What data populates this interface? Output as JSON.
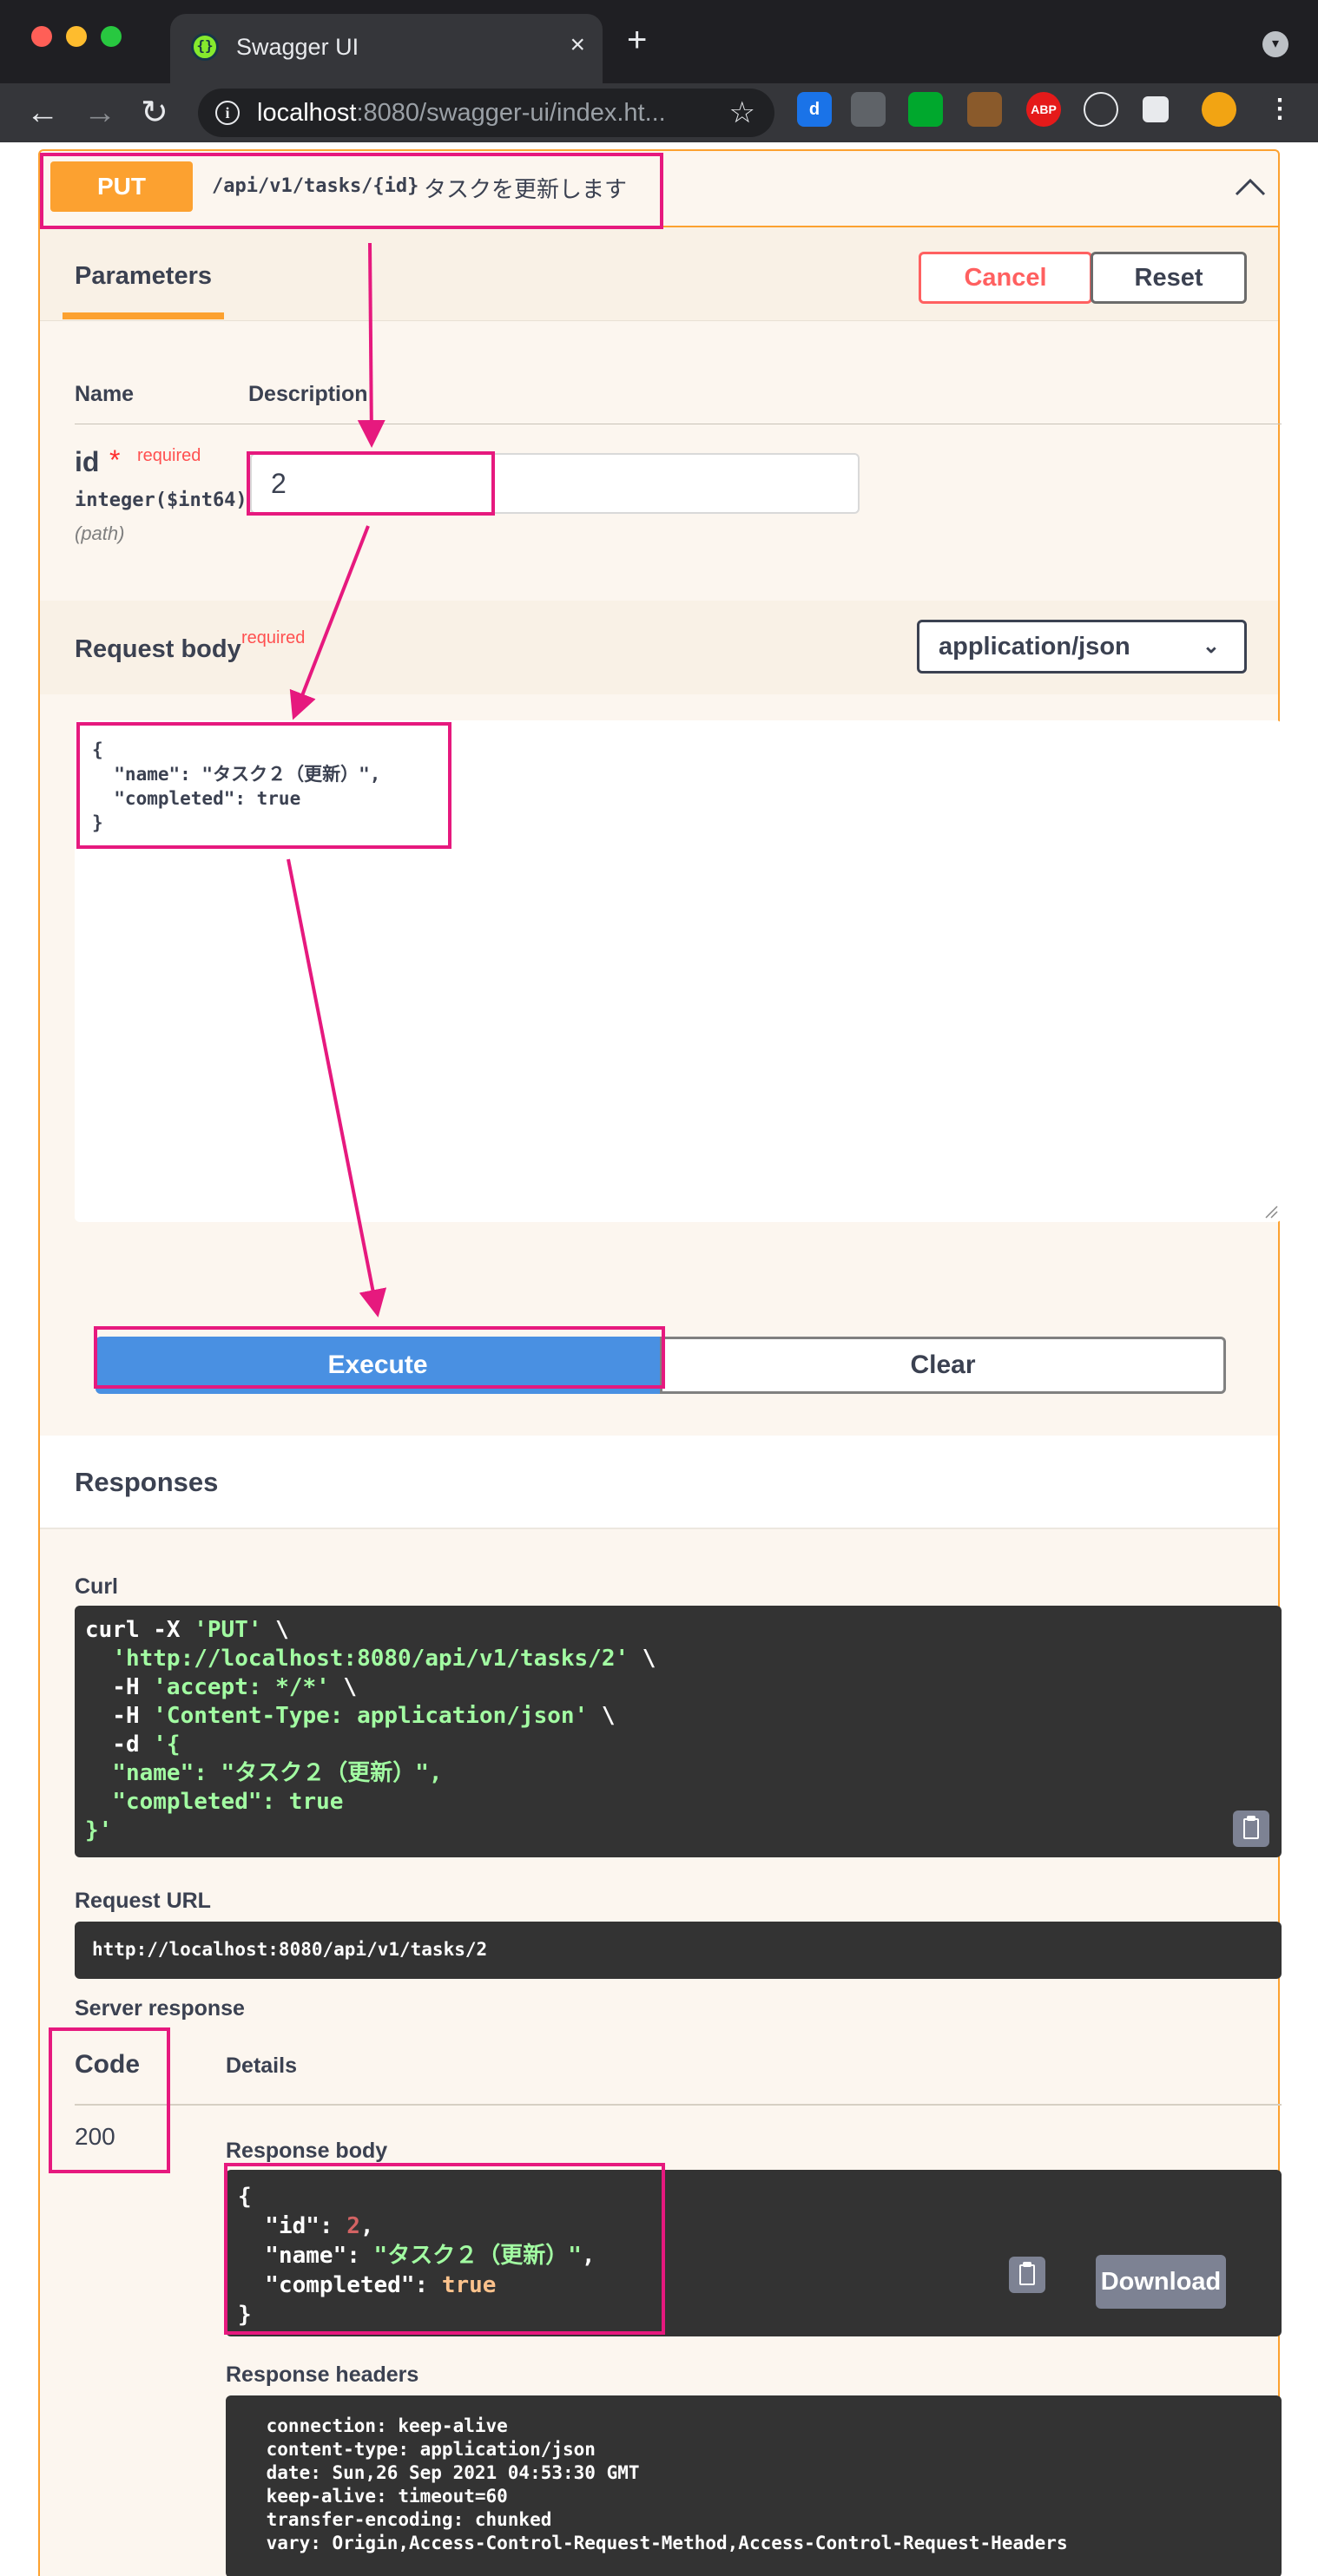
{
  "browser": {
    "tab_title": "Swagger UI",
    "tab_close": "×",
    "new_tab": "+",
    "url_host": "localhost",
    "url_rest": ":8080/swagger-ui/index.ht...",
    "nav_back": "←",
    "nav_forward": "→",
    "nav_reload": "↻",
    "info_glyph": "i",
    "star_glyph": "☆",
    "extensions": [
      {
        "name": "d-extension-icon",
        "label": "d",
        "color": "#1a73e8"
      },
      {
        "name": "pocket-icon",
        "label": "",
        "color": "#5f6368"
      },
      {
        "name": "evernote-icon",
        "label": "",
        "color": "#00a82d"
      },
      {
        "name": "owl-extension-icon",
        "label": "",
        "color": "#8a5a2b"
      },
      {
        "name": "adblock-plus-icon",
        "label": "ABP",
        "color": "#e51a1a"
      },
      {
        "name": "react-devtools-icon",
        "label": "",
        "color": "#35363a"
      },
      {
        "name": "extensions-puzzle-icon",
        "label": "",
        "color": "#35363a"
      },
      {
        "name": "profile-avatar",
        "label": "",
        "color": "#f2a413"
      },
      {
        "name": "browser-menu-icon",
        "label": "⋮",
        "color": "#35363a"
      }
    ],
    "menu_glyph": "▾"
  },
  "operation": {
    "method": "PUT",
    "path": "/api/v1/tasks/{id}",
    "summary": "タスクを更新します",
    "method_color": "#fca130"
  },
  "parameters": {
    "tab_label": "Parameters",
    "cancel_label": "Cancel",
    "reset_label": "Reset",
    "col_name": "Name",
    "col_description": "Description",
    "items": [
      {
        "name": "id",
        "required_star": "*",
        "required_label": "required",
        "type": "integer($int64)",
        "in": "(path)",
        "value": "2"
      }
    ]
  },
  "request_body": {
    "title": "Request body",
    "required_label": "required",
    "content_type": "application/json",
    "content_type_chevron": "⌄",
    "value": "{\n  \"name\": \"タスク２（更新）\",\n  \"completed\": true\n}"
  },
  "actions": {
    "execute_label": "Execute",
    "clear_label": "Clear"
  },
  "responses": {
    "title": "Responses",
    "curl_label": "Curl",
    "curl_lines": [
      [
        "curl -X ",
        "'PUT'",
        " \\"
      ],
      [
        "  ",
        "'http://localhost:8080/api/v1/tasks/2'",
        " \\"
      ],
      [
        "  -H ",
        "'accept: */*'",
        " \\"
      ],
      [
        "  -H ",
        "'Content-Type: application/json'",
        " \\"
      ],
      [
        "  -d ",
        "'{",
        ""
      ],
      [
        "  ",
        "\"name\": \"タスク２（更新）\",",
        ""
      ],
      [
        "  ",
        "\"completed\": true",
        ""
      ],
      [
        "",
        "}'",
        ""
      ]
    ],
    "request_url_label": "Request URL",
    "request_url": "http://localhost:8080/api/v1/tasks/2",
    "server_response_label": "Server response",
    "code_header": "Code",
    "details_header": "Details",
    "code": "200",
    "response_body_label": "Response body",
    "response_body": {
      "open": "{",
      "id_key": "  \"id\": ",
      "id_value": "2",
      "name_key": "  \"name\": ",
      "name_value": "\"タスク２（更新）\"",
      "completed_key": "  \"completed\": ",
      "completed_value": "true",
      "close": "}"
    },
    "download_label": "Download",
    "response_headers_label": "Response headers",
    "response_headers": " connection: keep-alive \n content-type: application/json \n date: Sun,26 Sep 2021 04:53:30 GMT \n keep-alive: timeout=60 \n transfer-encoding: chunked \n vary: Origin,Access-Control-Request-Method,Access-Control-Request-Headers "
  },
  "annotation_color": "#e6197e"
}
